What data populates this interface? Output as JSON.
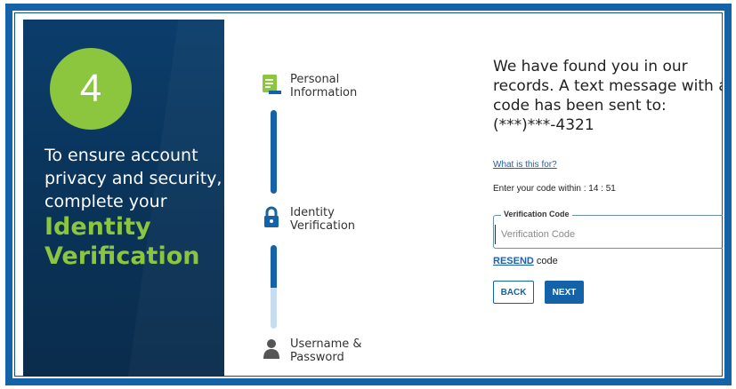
{
  "promo": {
    "step_number": "4",
    "line1": "To ensure account",
    "line2": "privacy and security,",
    "line3": "complete your",
    "highlight1": "Identity",
    "highlight2": "Verification"
  },
  "stepper": {
    "steps": [
      {
        "line1": "Personal",
        "line2": "Information",
        "icon": "document-icon"
      },
      {
        "line1": "Identity",
        "line2": "Verification",
        "icon": "lock-icon"
      },
      {
        "line1": "Username &",
        "line2": "Password",
        "icon": "user-icon"
      }
    ]
  },
  "form": {
    "heading_line1": "We have found you in our",
    "heading_line2": "records. A text message with a",
    "heading_line3": "code has been sent to:",
    "phone": "(***)***-4321",
    "help_link": "What is this for?",
    "timer": "Enter your code within : 14 : 51",
    "field_legend": "Verification Code",
    "field_placeholder": "Verification Code",
    "resend_link": "RESEND",
    "resend_suffix": " code",
    "back_label": "BACK",
    "next_label": "NEXT"
  },
  "colors": {
    "brand_blue": "#1463a8",
    "accent_green": "#8cc63f",
    "panel_navy": "#0b3d6b"
  }
}
